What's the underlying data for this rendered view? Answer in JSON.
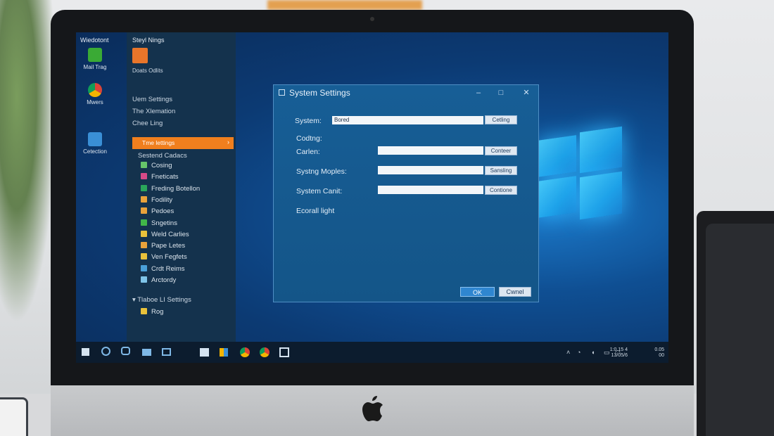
{
  "desktop": {
    "title": "Wiedotont",
    "icons": [
      {
        "label": "Mail Trag",
        "icon": "app-green-icon"
      },
      {
        "label": "Mwers",
        "icon": "chrome-icon"
      },
      {
        "label": "Cetection",
        "icon": "windows-store-icon"
      }
    ]
  },
  "start_panel": {
    "title": "Steyl Nings",
    "app_tile_label": "Doats Odlits",
    "links": [
      "Uem Settings",
      "The Xlemation",
      "Chee Ling"
    ],
    "highlighted": "Tme lettings",
    "section": "Sestend Cadacs",
    "items": [
      {
        "label": "Cosing",
        "color": "#66c46a"
      },
      {
        "label": "Fneticats",
        "color": "#d64a88"
      },
      {
        "label": "Freding Botellon",
        "color": "#2aa65a"
      },
      {
        "label": "Fodility",
        "color": "#e9a23b"
      },
      {
        "label": "Pedoes",
        "color": "#e9a23b"
      },
      {
        "label": "Sngetins",
        "color": "#41b649"
      },
      {
        "label": "Weld Carlies",
        "color": "#e9c23b"
      },
      {
        "label": "Pape Letes",
        "color": "#e9a23b"
      },
      {
        "label": "Ven Fegfets",
        "color": "#e9c23b"
      },
      {
        "label": "Crdt Reims",
        "color": "#4aa0d8"
      },
      {
        "label": "Arctordy",
        "color": "#7fc4e8"
      }
    ],
    "group": "Tlaboe LI Settings",
    "group_item": {
      "label": "Rog",
      "color": "#e9c23b"
    }
  },
  "dialog": {
    "title": "System Settings",
    "controls": [
      "–",
      "□",
      "✕"
    ],
    "rows": [
      {
        "label": "System:",
        "value": "Bored",
        "button": "Cetling"
      },
      {
        "label": "Codtng:",
        "value": "",
        "button": ""
      },
      {
        "label": "Carlen:",
        "value": "",
        "button": "Conteer"
      },
      {
        "label": "Systng Moples:",
        "value": "",
        "button": "Sansling"
      },
      {
        "label": "System Canit:",
        "value": "",
        "button": "Contione"
      },
      {
        "label": "Ecorall light",
        "value": "",
        "button": ""
      }
    ],
    "ok": "OK",
    "cancel": "Cwnel"
  },
  "taskbar": {
    "tray_line1": "1:0.15 4",
    "tray_line2": "13/05/6",
    "tray_right_top": "0.05",
    "tray_right_bottom": "00"
  }
}
